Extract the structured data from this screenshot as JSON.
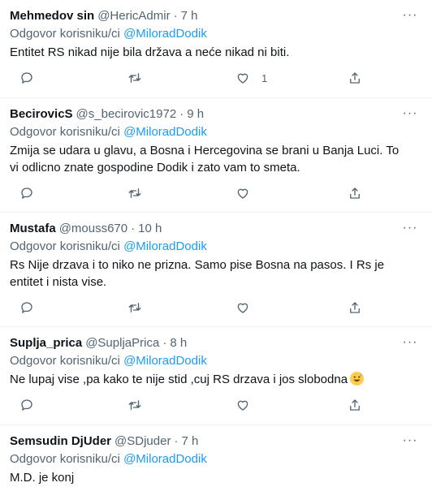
{
  "reply_prefix": "Odgovor korisniku/ci",
  "more_icon": "···",
  "tweets": [
    {
      "name": "Mehmedov sin",
      "handle": "@HericAdmir",
      "dot": "·",
      "time": "7 h",
      "mention": "@MiloradDodik",
      "text": "Entitet RS nikad nije bila država a neće nikad ni biti.",
      "like_count": "1"
    },
    {
      "name": "BecirovicS",
      "handle": "@s_becirovic1972",
      "dot": "·",
      "time": "9 h",
      "mention": "@MiloradDodik",
      "text": "Zmija se udara u glavu, a Bosna i Hercegovina se brani u Banja Luci. To vi odlicno znate gospodine Dodik i zato vam to smeta.",
      "like_count": ""
    },
    {
      "name": "Mustafa",
      "handle": "@mouss670",
      "dot": "·",
      "time": "10 h",
      "mention": "@MiloradDodik",
      "text": "Rs Nije drzava i to niko ne prizna. Samo pise Bosna na pasos. I Rs je entitet i nista vise.",
      "like_count": ""
    },
    {
      "name": "Suplja_prica",
      "handle": "@SupljaPrica",
      "dot": "·",
      "time": "8 h",
      "mention": "@MiloradDodik",
      "text": "Ne lupaj vise ,pa kako te nije stid ,cuj RS drzava i jos slobodna",
      "emoji": "grinning-sweat-emoji",
      "like_count": ""
    },
    {
      "name": "Semsudin DjUder",
      "handle": "@SDjuder",
      "dot": "·",
      "time": "7 h",
      "mention": "@MiloradDodik",
      "text": "M.D. je konj",
      "like_count": ""
    }
  ],
  "colors": {
    "text": "#0f1419",
    "secondary": "#536471",
    "link": "#1d9bf0",
    "divider": "#eff3f4"
  }
}
